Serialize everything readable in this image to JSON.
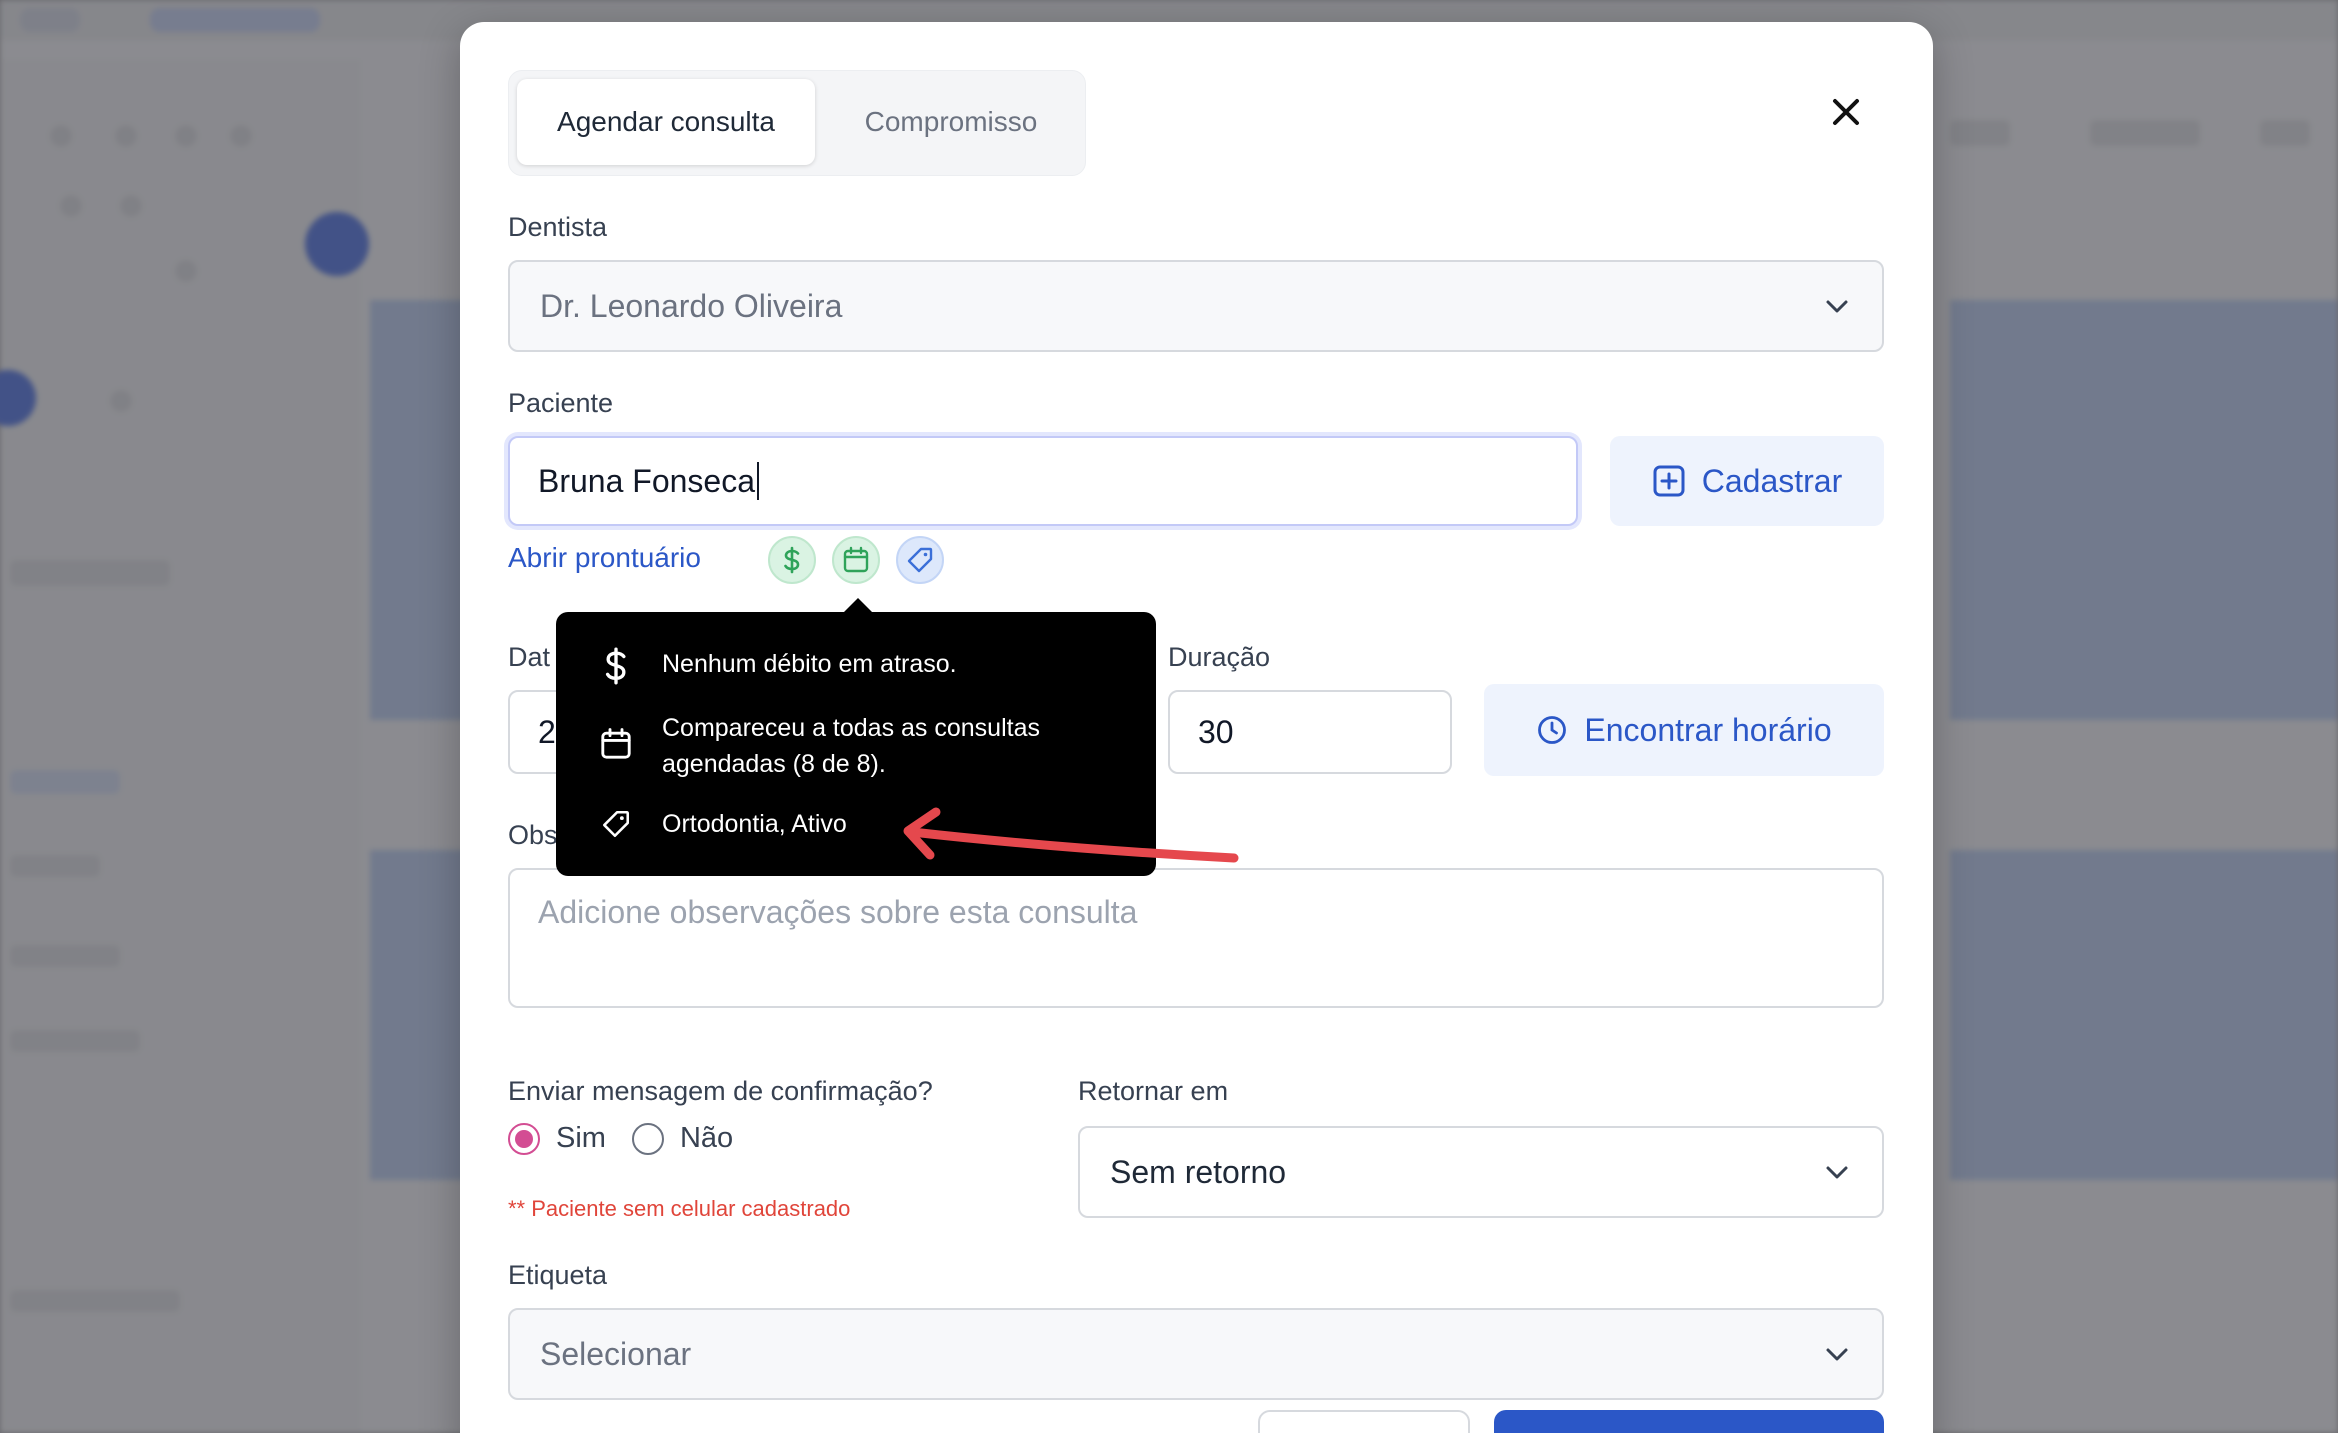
{
  "tabs": [
    {
      "label": "Agendar consulta",
      "active": true
    },
    {
      "label": "Compromisso",
      "active": false
    }
  ],
  "dentist": {
    "label": "Dentista",
    "value": "Dr. Leonardo Oliveira"
  },
  "patient": {
    "label": "Paciente",
    "value": "Bruna Fonseca",
    "register_button": "Cadastrar",
    "open_record_link": "Abrir prontuário"
  },
  "date": {
    "label_visible": "Dat",
    "value_visible": "2"
  },
  "duration": {
    "label": "Duração",
    "value": "30"
  },
  "find_time_button": "Encontrar horário",
  "notes": {
    "label_visible": "Obs",
    "placeholder": "Adicione observações sobre esta consulta"
  },
  "confirmation": {
    "label": "Enviar mensagem de confirmação?",
    "options": [
      "Sim",
      "Não"
    ],
    "selected": "Sim",
    "warning": "** Paciente sem celular cadastrado"
  },
  "return": {
    "label": "Retornar em",
    "value": "Sem retorno"
  },
  "tag": {
    "label": "Etiqueta",
    "placeholder": "Selecionar"
  },
  "tooltip": {
    "items": [
      {
        "icon": "dollar-icon",
        "lines": [
          "Nenhum débito em atraso."
        ]
      },
      {
        "icon": "calendar-icon",
        "lines": [
          "Compareceu a todas as consultas",
          "agendadas (8 de 8)."
        ]
      },
      {
        "icon": "tag-icon",
        "lines": [
          "Ortodontia, Ativo"
        ]
      }
    ]
  },
  "colors": {
    "accent_blue": "#2b57c7",
    "radio_pink": "#d34d93",
    "warning_red": "#e0453a",
    "annotation_arrow": "#e5484d",
    "status_green": "#2fa35a"
  }
}
